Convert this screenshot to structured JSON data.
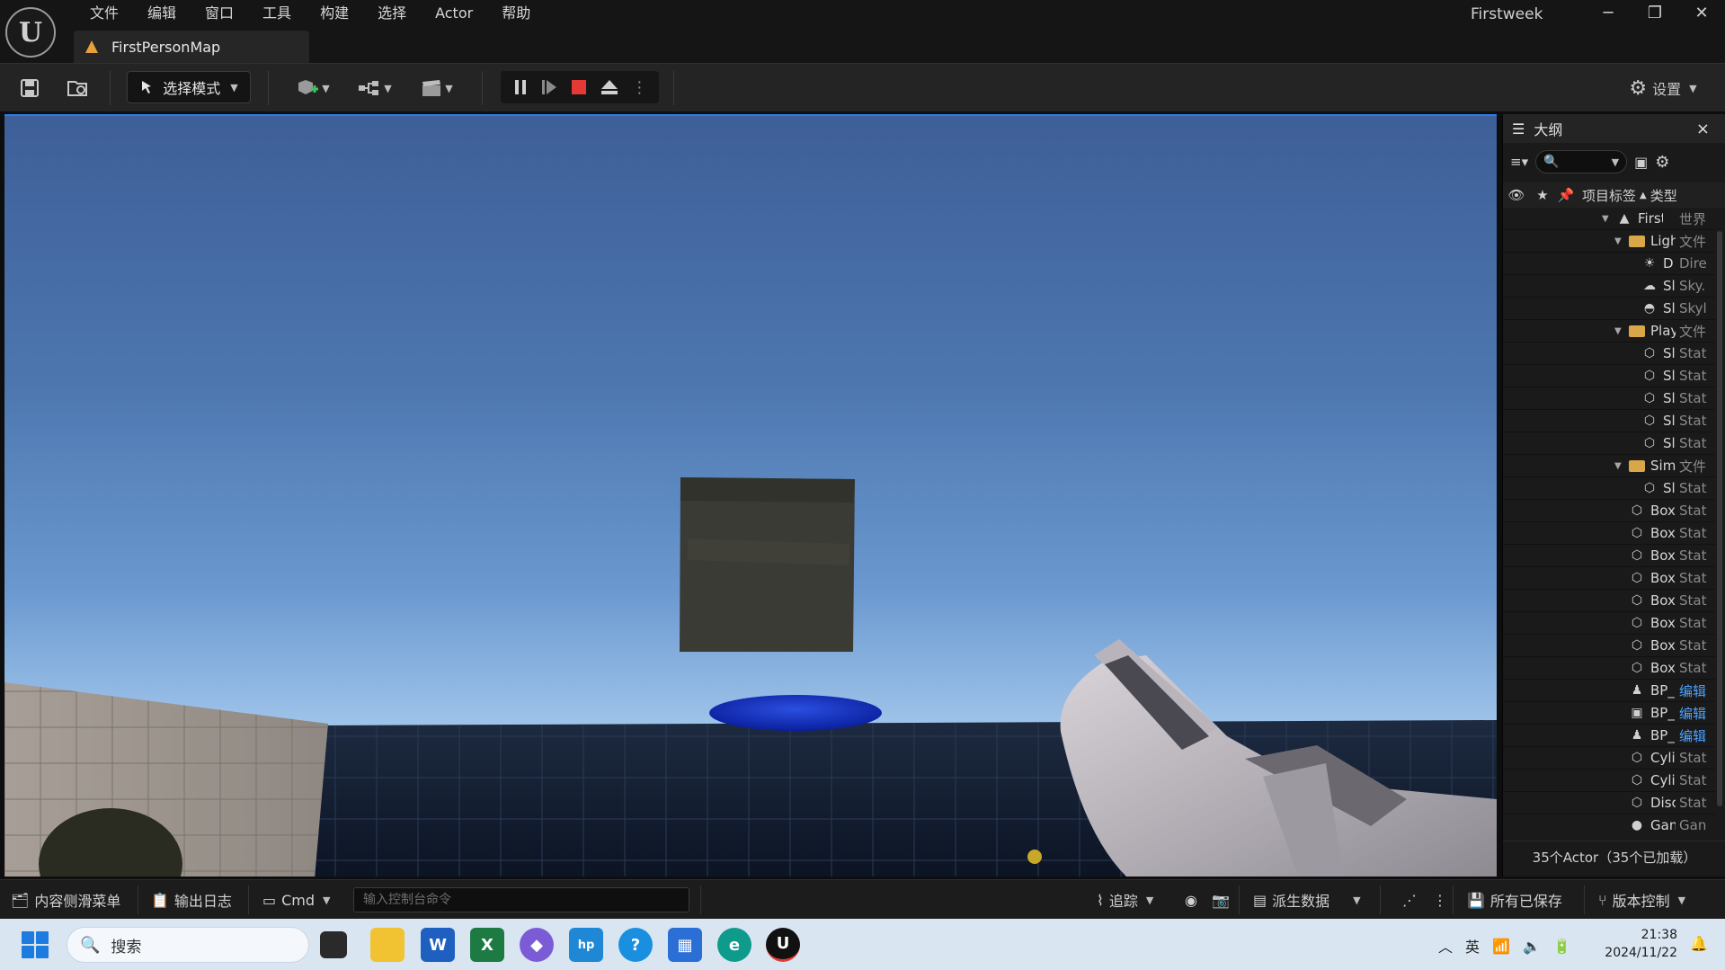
{
  "menu": [
    "文件",
    "编辑",
    "窗口",
    "工具",
    "构建",
    "选择",
    "Actor",
    "帮助"
  ],
  "tab": {
    "label": "FirstPersonMap"
  },
  "project_name": "Firstweek",
  "window": {
    "minimize": "─",
    "restore": "❐",
    "close": "✕"
  },
  "toolbar": {
    "mode_label": "选择模式",
    "settings_label": "设置"
  },
  "outliner": {
    "title": "大纲",
    "close": "×",
    "col_label": "项目标签",
    "col_type": "类型",
    "rows": [
      {
        "name": "FirstP",
        "type": "世界",
        "icon": "world-icon",
        "indent": 0,
        "tri": true
      },
      {
        "name": "Ligh",
        "type": "文件",
        "icon": "folder-icon",
        "indent": 1,
        "tri": true
      },
      {
        "name": "D",
        "type": "Dire",
        "icon": "sun-icon",
        "indent": 2
      },
      {
        "name": "Sl",
        "type": "Sky.",
        "icon": "sky-atmosphere-icon",
        "indent": 2
      },
      {
        "name": "Sl",
        "type": "Skyl",
        "icon": "skylight-icon",
        "indent": 2
      },
      {
        "name": "Play",
        "type": "文件",
        "icon": "folder-icon",
        "indent": 1,
        "tri": true
      },
      {
        "name": "Sl",
        "type": "Stat",
        "icon": "mesh-icon",
        "indent": 2
      },
      {
        "name": "Sl",
        "type": "Stat",
        "icon": "mesh-icon",
        "indent": 2
      },
      {
        "name": "Sl",
        "type": "Stat",
        "icon": "mesh-icon",
        "indent": 2
      },
      {
        "name": "Sl",
        "type": "Stat",
        "icon": "mesh-icon",
        "indent": 2
      },
      {
        "name": "Sl",
        "type": "Stat",
        "icon": "mesh-icon",
        "indent": 2
      },
      {
        "name": "Sim",
        "type": "文件",
        "icon": "folder-icon",
        "indent": 1,
        "tri": true
      },
      {
        "name": "Sl",
        "type": "Stat",
        "icon": "mesh-icon",
        "indent": 2
      },
      {
        "name": "Box",
        "type": "Stat",
        "icon": "mesh-icon",
        "indent": 1
      },
      {
        "name": "Box",
        "type": "Stat",
        "icon": "mesh-icon",
        "indent": 1
      },
      {
        "name": "Box",
        "type": "Stat",
        "icon": "mesh-icon",
        "indent": 1
      },
      {
        "name": "Box",
        "type": "Stat",
        "icon": "mesh-icon",
        "indent": 1
      },
      {
        "name": "Box",
        "type": "Stat",
        "icon": "mesh-icon",
        "indent": 1
      },
      {
        "name": "Box",
        "type": "Stat",
        "icon": "mesh-icon",
        "indent": 1
      },
      {
        "name": "Box",
        "type": "Stat",
        "icon": "mesh-icon",
        "indent": 1
      },
      {
        "name": "Box",
        "type": "Stat",
        "icon": "mesh-icon",
        "indent": 1
      },
      {
        "name": "BP_",
        "type": "编辑",
        "icon": "pawn-icon",
        "indent": 1,
        "link": true
      },
      {
        "name": "BP_",
        "type": "编辑",
        "icon": "hud-icon",
        "indent": 1,
        "link": true
      },
      {
        "name": "BP_",
        "type": "编辑",
        "icon": "pawn-icon",
        "indent": 1,
        "link": true
      },
      {
        "name": "Cyli",
        "type": "Stat",
        "icon": "mesh-icon",
        "indent": 1
      },
      {
        "name": "Cyli",
        "type": "Stat",
        "icon": "mesh-icon",
        "indent": 1
      },
      {
        "name": "Disc",
        "type": "Stat",
        "icon": "mesh-icon",
        "indent": 1
      },
      {
        "name": "Gan",
        "type": "Gan",
        "icon": "gamemode-icon",
        "indent": 1
      }
    ],
    "footer": "35个Actor（35个已加载）"
  },
  "statusbar": {
    "content_drawer": "内容侧滑菜单",
    "output_log": "输出日志",
    "cmd": "Cmd",
    "console_placeholder": "输入控制台命令",
    "trace": "追踪",
    "derived_data": "派生数据",
    "all_saved": "所有已保存",
    "source_control": "版本控制"
  },
  "taskbar": {
    "search_placeholder": "搜索",
    "ime": "英",
    "time": "21:38",
    "date": "2024/11/22"
  },
  "colors": {
    "accent": "#2a7cf0",
    "stop": "#e53935"
  }
}
